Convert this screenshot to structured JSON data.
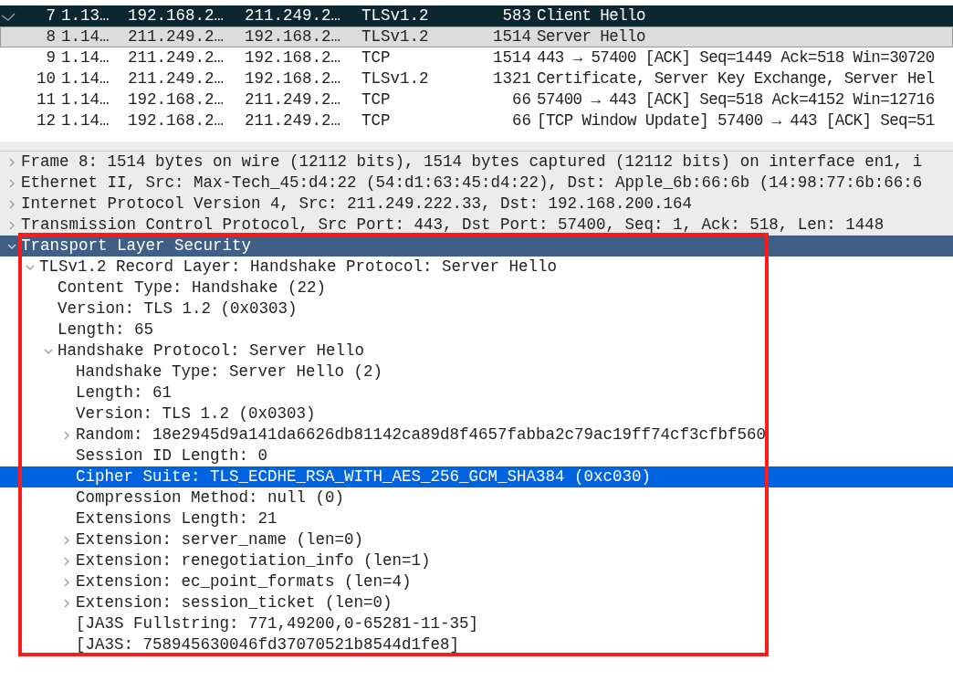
{
  "packet_list": {
    "rows": [
      {
        "no": "7",
        "time": "1.13…",
        "source": "192.168.2…",
        "destination": "211.249.2…",
        "protocol": "TLSv1.2",
        "length": "583",
        "info": "Client Hello",
        "selected": false,
        "marked": true
      },
      {
        "no": "8",
        "time": "1.14…",
        "source": "211.249.2…",
        "destination": "192.168.2…",
        "protocol": "TLSv1.2",
        "length": "1514",
        "info": "Server Hello",
        "selected": true,
        "marked": false
      },
      {
        "no": "9",
        "time": "1.14…",
        "source": "211.249.2…",
        "destination": "192.168.2…",
        "protocol": "TCP",
        "length": "1514",
        "info": "443 → 57400 [ACK] Seq=1449 Ack=518 Win=30720",
        "selected": false,
        "marked": false
      },
      {
        "no": "10",
        "time": "1.14…",
        "source": "211.249.2…",
        "destination": "192.168.2…",
        "protocol": "TLSv1.2",
        "length": "1321",
        "info": "Certificate, Server Key Exchange, Server Hel",
        "selected": false,
        "marked": false
      },
      {
        "no": "11",
        "time": "1.14…",
        "source": "192.168.2…",
        "destination": "211.249.2…",
        "protocol": "TCP",
        "length": "66",
        "info": "57400 → 443 [ACK] Seq=518 Ack=4152 Win=12716",
        "selected": false,
        "marked": false
      },
      {
        "no": "12",
        "time": "1.14…",
        "source": "192.168.2…",
        "destination": "211.249.2…",
        "protocol": "TCP",
        "length": "66",
        "info": "[TCP Window Update] 57400 → 443 [ACK] Seq=51",
        "selected": false,
        "marked": false
      }
    ]
  },
  "packet_details": [
    {
      "label": "Frame 8: 1514 bytes on wire (12112 bits), 1514 bytes captured (12112 bits) on interface en1, i",
      "kind": "node",
      "expanded": false,
      "selected": false
    },
    {
      "label": "Ethernet II, Src: Max-Tech_45:d4:22 (54:d1:63:45:d4:22), Dst: Apple_6b:66:6b (14:98:77:6b:66:6",
      "kind": "node",
      "expanded": false,
      "selected": false
    },
    {
      "label": "Internet Protocol Version 4, Src: 211.249.222.33, Dst: 192.168.200.164",
      "kind": "node",
      "expanded": false,
      "selected": false
    },
    {
      "label": "Transmission Control Protocol, Src Port: 443, Dst Port: 57400, Seq: 1, Ack: 518, Len: 1448",
      "kind": "node",
      "expanded": false,
      "selected": false
    },
    {
      "label": "Transport Layer Security",
      "kind": "node",
      "expanded": true,
      "selected": false,
      "children": [
        {
          "label": "TLSv1.2 Record Layer: Handshake Protocol: Server Hello",
          "kind": "node",
          "expanded": true,
          "selected": false,
          "children": [
            {
              "label": "Content Type: Handshake (22)",
              "kind": "leaf",
              "expanded": false,
              "selected": false
            },
            {
              "label": "Version: TLS 1.2 (0x0303)",
              "kind": "leaf",
              "expanded": false,
              "selected": false
            },
            {
              "label": "Length: 65",
              "kind": "leaf",
              "expanded": false,
              "selected": false
            },
            {
              "label": "Handshake Protocol: Server Hello",
              "kind": "node",
              "expanded": true,
              "selected": false,
              "children": [
                {
                  "label": "Handshake Type: Server Hello (2)",
                  "kind": "leaf",
                  "expanded": false,
                  "selected": false
                },
                {
                  "label": "Length: 61",
                  "kind": "leaf",
                  "expanded": false,
                  "selected": false
                },
                {
                  "label": "Version: TLS 1.2 (0x0303)",
                  "kind": "leaf",
                  "expanded": false,
                  "selected": false
                },
                {
                  "label": "Random: 18e2945d9a141da6626db81142ca89d8f4657fabba2c79ac19ff74cf3cfbf560",
                  "kind": "node",
                  "expanded": false,
                  "selected": false
                },
                {
                  "label": "Session ID Length: 0",
                  "kind": "leaf",
                  "expanded": false,
                  "selected": false
                },
                {
                  "label": "Cipher Suite: TLS_ECDHE_RSA_WITH_AES_256_GCM_SHA384 (0xc030)",
                  "kind": "leaf",
                  "expanded": false,
                  "selected": true
                },
                {
                  "label": "Compression Method: null (0)",
                  "kind": "leaf",
                  "expanded": false,
                  "selected": false
                },
                {
                  "label": "Extensions Length: 21",
                  "kind": "leaf",
                  "expanded": false,
                  "selected": false
                },
                {
                  "label": "Extension: server_name (len=0)",
                  "kind": "node",
                  "expanded": false,
                  "selected": false
                },
                {
                  "label": "Extension: renegotiation_info (len=1)",
                  "kind": "node",
                  "expanded": false,
                  "selected": false
                },
                {
                  "label": "Extension: ec_point_formats (len=4)",
                  "kind": "node",
                  "expanded": false,
                  "selected": false
                },
                {
                  "label": "Extension: session_ticket (len=0)",
                  "kind": "node",
                  "expanded": false,
                  "selected": false
                },
                {
                  "label": "[JA3S Fullstring: 771,49200,0-65281-11-35]",
                  "kind": "leaf",
                  "expanded": false,
                  "selected": false
                },
                {
                  "label": "[JA3S: 758945630046fd37070521b8544d1fe8]",
                  "kind": "leaf",
                  "expanded": false,
                  "selected": false
                }
              ]
            }
          ]
        }
      ]
    }
  ]
}
